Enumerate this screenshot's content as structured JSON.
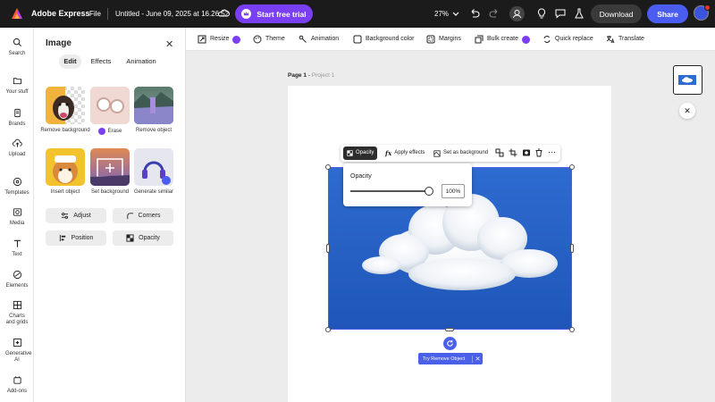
{
  "topbar": {
    "app_name": "Adobe Express",
    "file_menu": "File",
    "doc_title": "Untitled - June 09, 2025 at 16.26.52",
    "trial_button": "Start free trial",
    "zoom": "27%",
    "download": "Download",
    "share": "Share",
    "notification_count": "1"
  },
  "rail": [
    {
      "label": "Search",
      "icon": "search-icon"
    },
    {
      "label": "Your stuff",
      "icon": "folder-icon"
    },
    {
      "label": "Brands",
      "icon": "brand-icon"
    },
    {
      "label": "Upload",
      "icon": "upload-icon"
    },
    {
      "label": "Templates",
      "icon": "templates-icon"
    },
    {
      "label": "Media",
      "icon": "media-icon"
    },
    {
      "label": "Text",
      "icon": "text-icon"
    },
    {
      "label": "Elements",
      "icon": "elements-icon"
    },
    {
      "label": "Charts and grids",
      "icon": "charts-icon"
    },
    {
      "label": "Generative AI",
      "icon": "ai-icon"
    },
    {
      "label": "Add-ons",
      "icon": "addons-icon"
    }
  ],
  "panel": {
    "title": "Image",
    "tabs": [
      "Edit",
      "Effects",
      "Animation"
    ],
    "tools": [
      {
        "label": "Remove background"
      },
      {
        "label": "Erase"
      },
      {
        "label": "Remove object"
      },
      {
        "label": "Insert object"
      },
      {
        "label": "Set background"
      },
      {
        "label": "Generate similar"
      }
    ],
    "buttons": [
      "Adjust",
      "Corners",
      "Position",
      "Opacity"
    ]
  },
  "toolbar": [
    "Resize",
    "Theme",
    "Animation",
    "Background color",
    "Margins",
    "Bulk create",
    "Quick replace",
    "Translate"
  ],
  "canvas": {
    "page_label": "Page 1",
    "page_sub": "Project 1"
  },
  "context_menu": {
    "opacity": "Opacity",
    "apply_effects": "Apply effects",
    "set_background": "Set as background"
  },
  "opacity_popover": {
    "title": "Opacity",
    "value": "100%",
    "level": 1.0
  },
  "try_remove": "Try Remove Object",
  "colors": {
    "accent": "#4a60e8",
    "premium": "#7a3ff2",
    "topbar": "#1b1b1b"
  }
}
